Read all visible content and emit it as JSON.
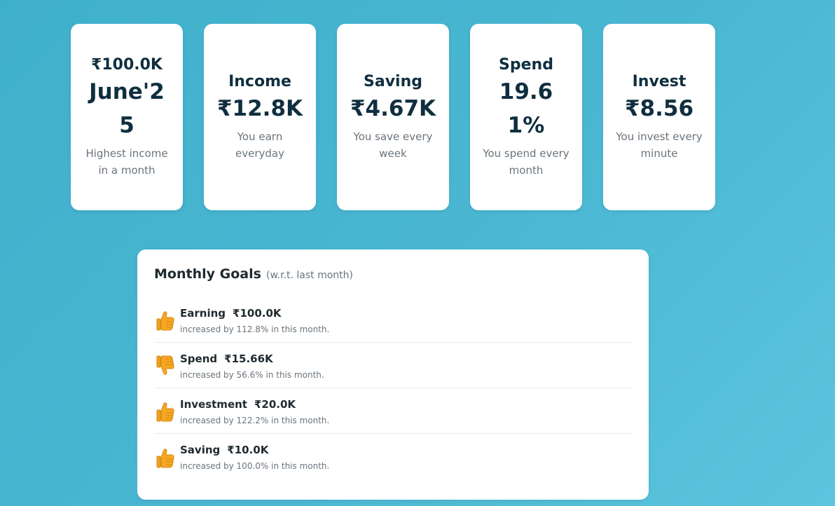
{
  "cards": [
    {
      "title": "₹100.0K",
      "value": "June'25",
      "desc": "Highest income in a month"
    },
    {
      "title": "Income",
      "value": "₹12.8K",
      "desc": "You earn everyday"
    },
    {
      "title": "Saving",
      "value": "₹4.67K",
      "desc": "You save every week"
    },
    {
      "title": "Spend",
      "value": "19.61%",
      "desc": "You spend every month"
    },
    {
      "title": "Invest",
      "value": "₹8.56",
      "desc": "You invest every minute"
    }
  ],
  "goals": {
    "title": "Monthly Goals",
    "subtitle": "(w.r.t. last month)",
    "items": [
      {
        "label": "Earning",
        "amount": "₹100.0K",
        "note": "increased by 112.8% in this month.",
        "icon": "thumbs-up-icon"
      },
      {
        "label": "Spend",
        "amount": "₹15.66K",
        "note": "increased by 56.6% in this month.",
        "icon": "thumbs-down-icon"
      },
      {
        "label": "Investment",
        "amount": "₹20.0K",
        "note": "increased by 122.2% in this month.",
        "icon": "thumbs-up-icon"
      },
      {
        "label": "Saving",
        "amount": "₹10.0K",
        "note": "increased by 100.0% in this month.",
        "icon": "thumbs-up-icon"
      }
    ]
  },
  "colors": {
    "background": "#45b3ce",
    "card": "#ffffff",
    "heading": "#0f2f3f",
    "muted": "#6a747c",
    "icon": "#f5a623"
  }
}
